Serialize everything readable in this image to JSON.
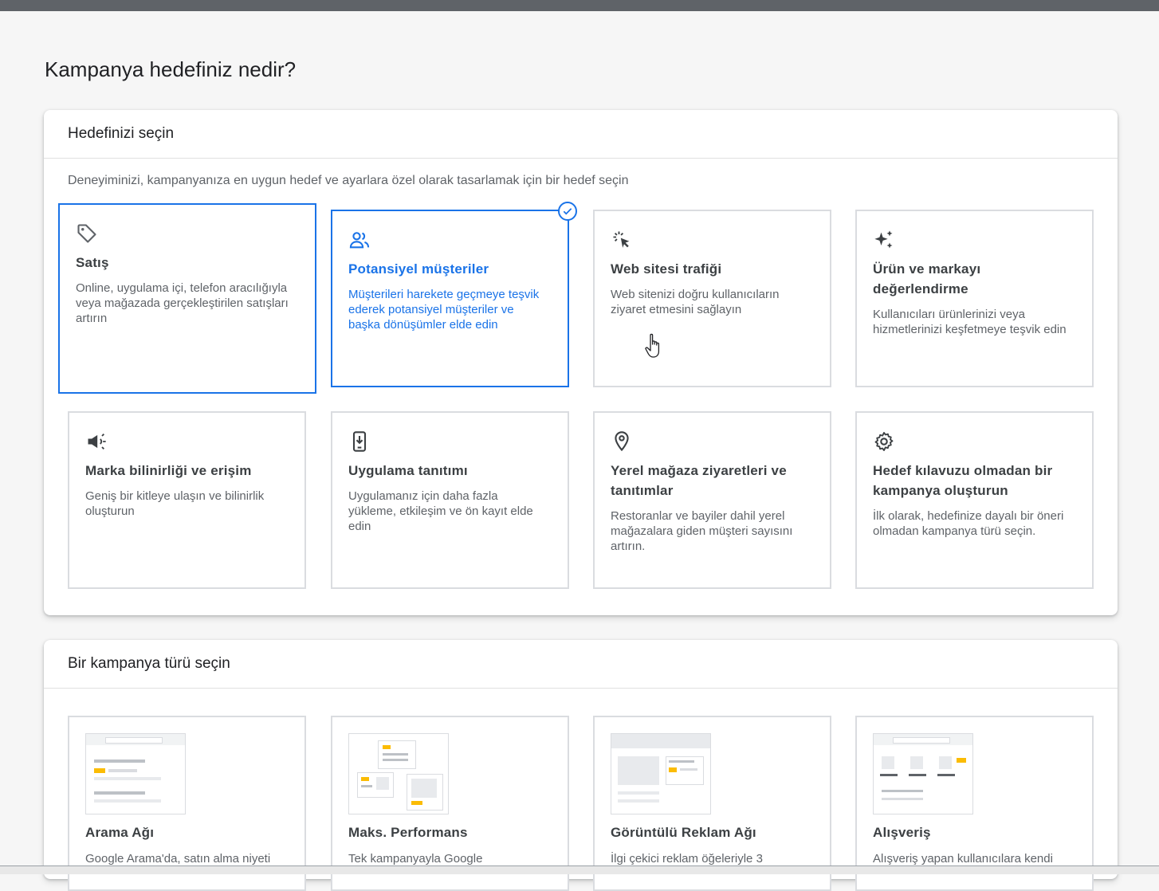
{
  "page": {
    "title": "Kampanya hedefiniz nedir?"
  },
  "goal_panel": {
    "header": "Hedefinizi seçin",
    "description": "Deneyiminizi, kampanyanıza en uygun hedef ve ayarlara özel olarak tasarlamak için bir hedef seçin",
    "cards": [
      {
        "title": "Satış",
        "description": "Online, uygulama içi, telefon aracılığıyla veya mağazada gerçekleştirilen satışları artırın",
        "icon": "tag-icon",
        "state": "focused"
      },
      {
        "title": "Potansiyel müşteriler",
        "description": "Müşterileri harekete geçmeye teşvik ederek potansiyel müşteriler ve başka dönüşümler elde edin",
        "icon": "people-icon",
        "state": "selected"
      },
      {
        "title": "Web sitesi trafiği",
        "description": "Web sitenizi doğru kullanıcıların ziyaret etmesini sağlayın",
        "icon": "cursor-click-icon",
        "state": "default"
      },
      {
        "title": "Ürün ve markayı değerlendirme",
        "description": "Kullanıcıları ürünlerinizi veya hizmetlerinizi keşfetmeye teşvik edin",
        "icon": "sparkle-icon",
        "state": "default"
      },
      {
        "title": "Marka bilinirliği ve erişim",
        "description": "Geniş bir kitleye ulaşın ve bilinirlik oluşturun",
        "icon": "megaphone-icon",
        "state": "default"
      },
      {
        "title": "Uygulama tanıtımı",
        "description": "Uygulamanız için daha fazla yükleme, etkileşim ve ön kayıt elde edin",
        "icon": "phone-download-icon",
        "state": "default"
      },
      {
        "title": "Yerel mağaza ziyaretleri ve tanıtımlar",
        "description": "Restoranlar ve bayiler dahil yerel mağazalara giden müşteri sayısını artırın.",
        "icon": "location-pin-icon",
        "state": "default"
      },
      {
        "title": "Hedef kılavuzu olmadan bir kampanya oluşturun",
        "description": "İlk olarak, hedefinize dayalı bir öneri olmadan kampanya türü seçin.",
        "icon": "gear-icon",
        "state": "default"
      }
    ]
  },
  "type_panel": {
    "header": "Bir kampanya türü seçin",
    "cards": [
      {
        "title": "Arama Ağı",
        "description": "Google Arama'da, satın alma niyeti"
      },
      {
        "title": "Maks. Performans",
        "description": "Tek kampanyayla Google"
      },
      {
        "title": "Görüntülü Reklam Ağı",
        "description": "İlgi çekici reklam öğeleriyle 3"
      },
      {
        "title": "Alışveriş",
        "description": "Alışveriş yapan kullanıcılara kendi"
      }
    ]
  },
  "colors": {
    "accent": "#1a73e8",
    "thumb_yellow": "#fbbc04"
  }
}
